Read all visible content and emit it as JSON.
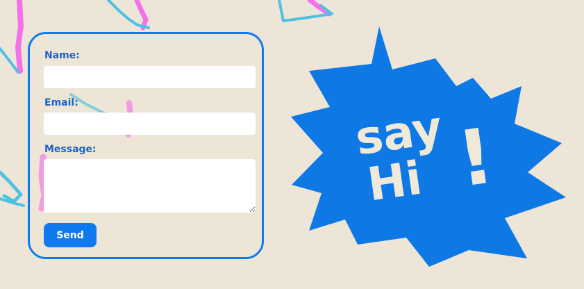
{
  "form": {
    "name_label": "Name:",
    "name_value": "",
    "email_label": "Email:",
    "email_value": "",
    "message_label": "Message:",
    "message_value": "",
    "send_label": "Send"
  },
  "graphic": {
    "line1": "say",
    "line2": "Hi",
    "exclaim": "!"
  },
  "colors": {
    "accent": "#0f7af0",
    "label": "#1d63c6",
    "background": "#ede6d8",
    "doodle_pink": "#f472e8",
    "doodle_cyan": "#4ec1e0",
    "burst_text": "#efe9d9"
  }
}
